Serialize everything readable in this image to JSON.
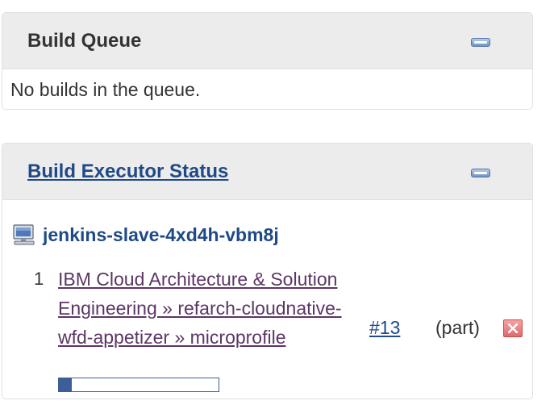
{
  "build_queue": {
    "title": "Build Queue",
    "empty_message": "No builds in the queue."
  },
  "executor_status": {
    "title": "Build Executor Status",
    "node": {
      "name": "jenkins-slave-4xd4h-vbm8j",
      "icon": "computer-icon"
    },
    "executors": [
      {
        "number": "1",
        "job": "IBM Cloud Architecture & Solution Engineering » refarch-cloudnative-wfd-appetizer » microprofile",
        "build": "#13",
        "status": "(part)",
        "progress": 0.08
      }
    ]
  },
  "colors": {
    "header_bg": "#ececec",
    "link_blue": "#204a87",
    "visited_link": "#5c3566",
    "progress": "#3c5f9a",
    "stop_red": "#e26a6a"
  }
}
